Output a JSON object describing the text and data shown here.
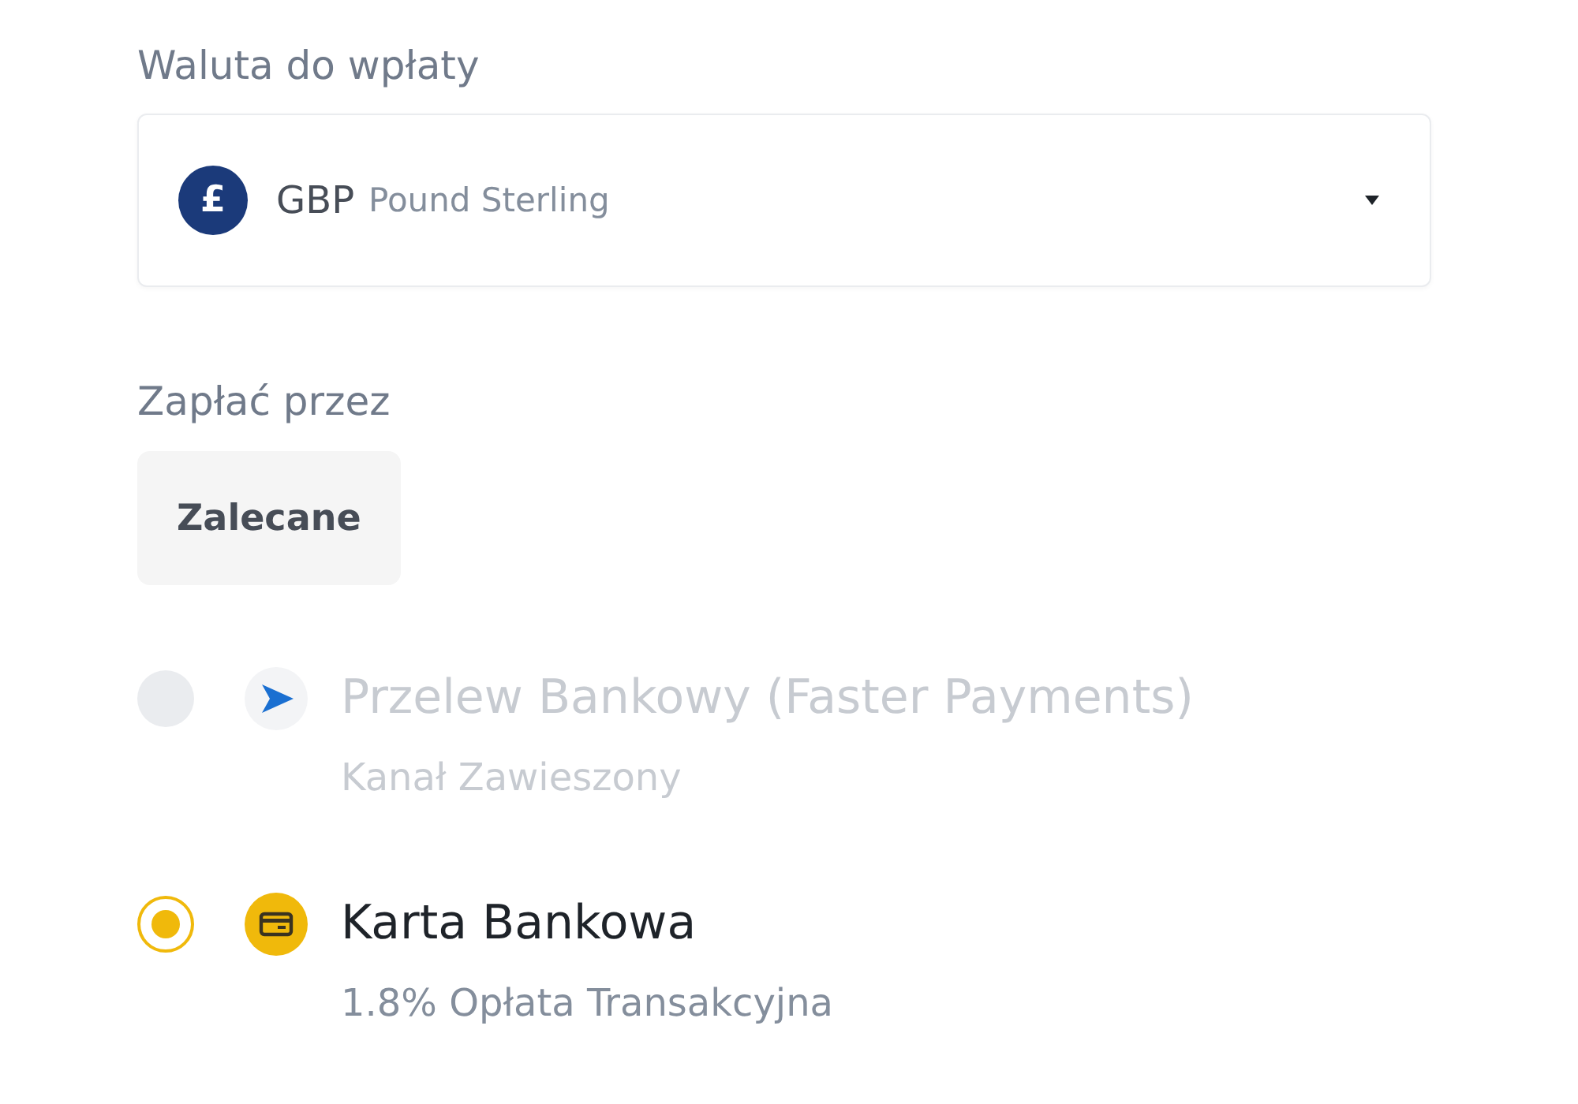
{
  "currency_field": {
    "label": "Waluta do wpłaty",
    "symbol": "£",
    "code": "GBP",
    "name": "Pound Sterling"
  },
  "payment": {
    "label": "Zapłać przez",
    "tabs": [
      {
        "label": "Zalecane",
        "selected": true
      }
    ],
    "options": [
      {
        "kind": "transfer",
        "title": "Przelew Bankowy (Faster Payments)",
        "subtitle": "Kanał Zawieszony",
        "disabled": true,
        "selected": false
      },
      {
        "kind": "card",
        "title": "Karta Bankowa",
        "subtitle": "1.8% Opłata Transakcyjna",
        "disabled": false,
        "selected": true
      }
    ]
  }
}
